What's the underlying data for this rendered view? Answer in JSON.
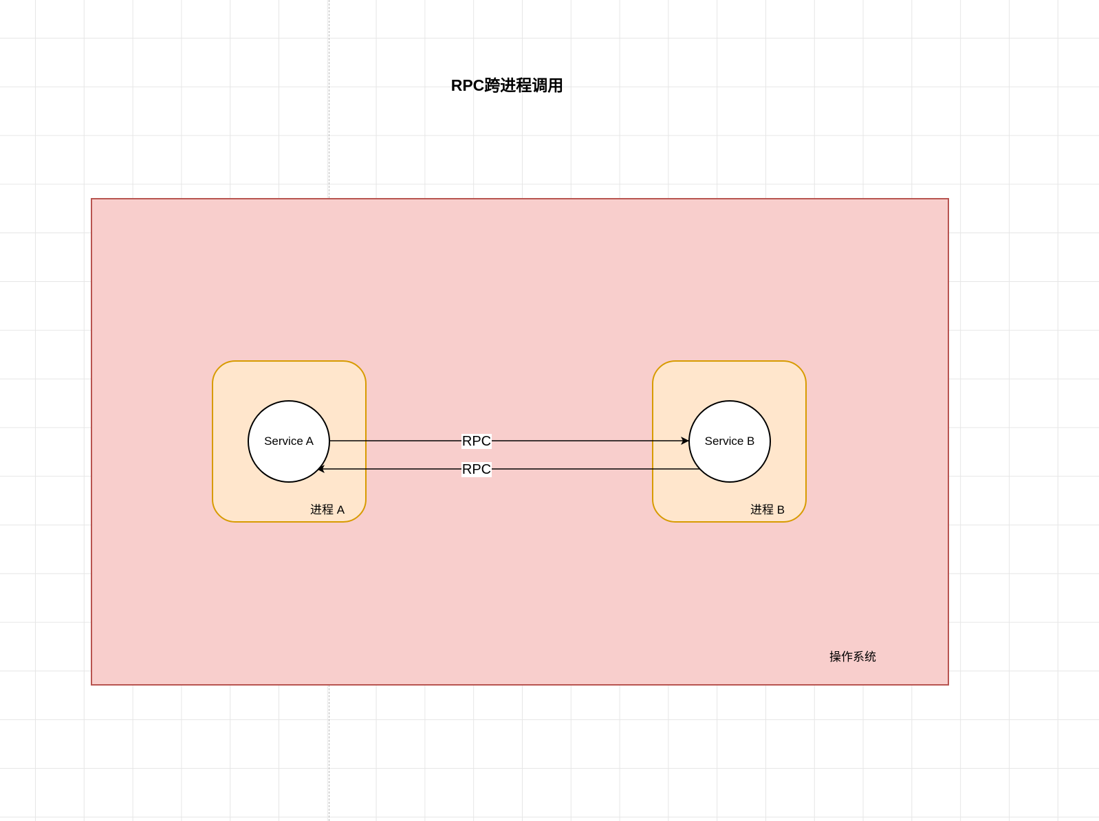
{
  "diagram": {
    "title": "RPC跨进程调用",
    "os": {
      "label": "操作系统"
    },
    "process_a": {
      "label": "进程 A",
      "service": "Service A"
    },
    "process_b": {
      "label": "进程 B",
      "service": "Service B"
    },
    "edges": [
      {
        "from": "Service A",
        "to": "Service B",
        "label": "RPC"
      },
      {
        "from": "Service B",
        "to": "Service A",
        "label": "RPC"
      }
    ],
    "colors": {
      "os_fill": "#f8cecc",
      "os_stroke": "#b85450",
      "process_fill": "#ffe6cc",
      "process_stroke": "#d79b00",
      "grid": "#e6e6e6"
    }
  }
}
